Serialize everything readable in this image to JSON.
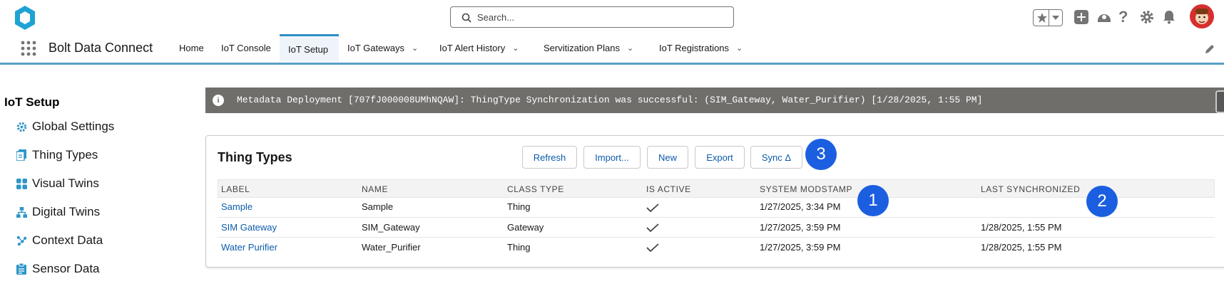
{
  "header": {
    "search": {
      "placeholder": "Search..."
    },
    "app_name": "Bolt Data Connect"
  },
  "nav": {
    "tabs": [
      {
        "label": "Home",
        "has_menu": false
      },
      {
        "label": "IoT Console",
        "has_menu": false
      },
      {
        "label": "IoT Setup",
        "has_menu": false,
        "active": true
      },
      {
        "label": "IoT Gateways",
        "has_menu": true
      },
      {
        "label": "IoT Alert History",
        "has_menu": true
      },
      {
        "label": "Servitization Plans",
        "has_menu": true
      },
      {
        "label": "IoT Registrations",
        "has_menu": true
      }
    ]
  },
  "sidebar": {
    "title": "IoT Setup",
    "items": [
      {
        "label": "Global Settings",
        "icon": "gear-icon"
      },
      {
        "label": "Thing Types",
        "icon": "document-icon"
      },
      {
        "label": "Visual Twins",
        "icon": "grid-icon"
      },
      {
        "label": "Digital Twins",
        "icon": "hierarchy-icon"
      },
      {
        "label": "Context Data",
        "icon": "network-icon"
      },
      {
        "label": "Sensor Data",
        "icon": "clipboard-icon"
      }
    ]
  },
  "banner": {
    "message": "Metadata Deployment [707fJ000008UMhNQAW]: ThingType Synchronization was successful: (SIM_Gateway, Water_Purifier) [1/28/2025, 1:55 PM]"
  },
  "card": {
    "title": "Thing Types",
    "buttons": [
      "Refresh",
      "Import...",
      "New",
      "Export",
      "Sync Δ"
    ],
    "columns": [
      "LABEL",
      "NAME",
      "CLASS TYPE",
      "IS ACTIVE",
      "SYSTEM MODSTAMP",
      "LAST SYNCHRONIZED"
    ],
    "rows": [
      {
        "label": "Sample",
        "name": "Sample",
        "class_type": "Thing",
        "is_active": true,
        "modstamp": "1/27/2025, 3:34 PM",
        "last_sync": ""
      },
      {
        "label": "SIM Gateway",
        "name": "SIM_Gateway",
        "class_type": "Gateway",
        "is_active": true,
        "modstamp": "1/27/2025, 3:59 PM",
        "last_sync": "1/28/2025, 1:55 PM"
      },
      {
        "label": "Water Purifier",
        "name": "Water_Purifier",
        "class_type": "Thing",
        "is_active": true,
        "modstamp": "1/27/2025, 3:59 PM",
        "last_sync": "1/28/2025, 1:55 PM"
      }
    ]
  },
  "annotations": [
    "1",
    "2",
    "3"
  ],
  "colors": {
    "accent": "#0b5cab",
    "nav_underline": "#56a0c7",
    "banner": "#706e6b",
    "badge": "#1b5fe0"
  }
}
